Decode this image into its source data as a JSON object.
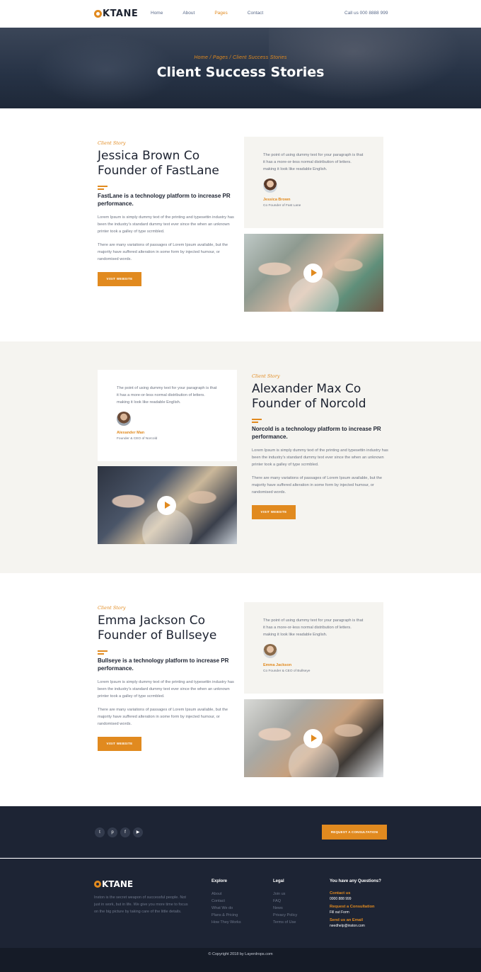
{
  "header": {
    "logo": "OKTANE",
    "nav": [
      {
        "label": "Home"
      },
      {
        "label": "About"
      },
      {
        "label": "Pages"
      },
      {
        "label": "Contact"
      }
    ],
    "active_nav": "Pages",
    "call": "Call us 000 8888 999"
  },
  "hero": {
    "breadcrumb": "Home / Pages / Client Success Stories",
    "title": "Client Success Stories"
  },
  "stories": [
    {
      "tag": "Client Story",
      "title_line1": "Jessica Brown Co",
      "title_line2": "Founder of FastLane",
      "lead": "FastLane is a technology platform to increase PR performance.",
      "para1": "Lorem Ipsum is simply dummy text of the printing and typesettin industry has been the industry's standard dummy text ever since the when an unknown printer took a galley of type scrmbled.",
      "para2": "There are many variations of passages of Lorem Ipsum available, but the majority have suffered alteration in some form by injected humour, or randomised words.",
      "button": "VISIT WEBSITE",
      "quote": "The point of using dummy text for your paragraph is that it has a more-or-less normal distribution of letters. making it look like readable English.",
      "name": "Jessica Brown",
      "role": "Co Founder of Fast Lane"
    },
    {
      "tag": "Client Story",
      "title_line1": "Alexander Max Co",
      "title_line2": "Founder of Norcold",
      "lead": "Norcold is a technology platform to increase PR performance.",
      "para1": "Lorem Ipsum is simply dummy text of the printing and typesettin industry has been the industry's standard dummy text ever since the when an unknown printer took a galley of type scrmbled.",
      "para2": "There are many variations of passages of Lorem Ipsum available, but the majority have suffered alteration in some form by injected humour, or randomised words.",
      "button": "VISIT WEBSITE",
      "quote": "The point of using dummy text for your paragraph is that it has a more-or-less normal distribution of letters. making it look like readable English.",
      "name": "Alexander Man",
      "role": "Founder & CEO of Norcold"
    },
    {
      "tag": "Client Story",
      "title_line1": "Emma Jackson Co",
      "title_line2": "Founder of Bullseye",
      "lead": "Bullseye is a technology platform to increase PR performance.",
      "para1": "Lorem Ipsum is simply dummy text of the printing and typesettin industry has been the industry's standard dummy text ever since the when an unknown printer took a galley of type scrmbled.",
      "para2": "There are many variations of passages of Lorem Ipsum available, but the majority have suffered alteration in some form by injected humour, or randomised words.",
      "button": "VISIT WEBSITE",
      "quote": "The point of using dummy text for your paragraph is that it has a more-or-less normal distribution of letters. making it look like readable English.",
      "name": "Emma Jackson",
      "role": "Co Founder & CEO of Bullseye"
    }
  ],
  "footer": {
    "social": [
      "twitter-icon",
      "pinterest-icon",
      "facebook-icon",
      "youtube-icon"
    ],
    "consult_button": "REQUEST A CONSULTATION",
    "logo": "OKTANE",
    "about": "Inston is the secret weapon of successful people. Not just in work, but in life. We give you more time to focus on the big picture by taking care of the little details.",
    "explore_title": "Explore",
    "explore": [
      "About",
      "Contact",
      "What We do",
      "Plans & Pricing",
      "How They Works"
    ],
    "legal_title": "Legal",
    "legal": [
      "Join us",
      "FAQ",
      "News",
      "Privacy Policy",
      "Terms of Use"
    ],
    "questions_title": "You have any Questions?",
    "contact": [
      {
        "title": "Contact us",
        "value": "0000 888 999"
      },
      {
        "title": "Request a Consultation",
        "value": "Fill out Form"
      },
      {
        "title": "Send us an Email",
        "value": "needhelp@inston.com"
      }
    ],
    "copyright": "© Copyright 2018 by Layerdrops.com"
  },
  "colors": {
    "accent": "#e18a1f",
    "dark": "#1d2434",
    "beige": "#f5f4f0"
  }
}
